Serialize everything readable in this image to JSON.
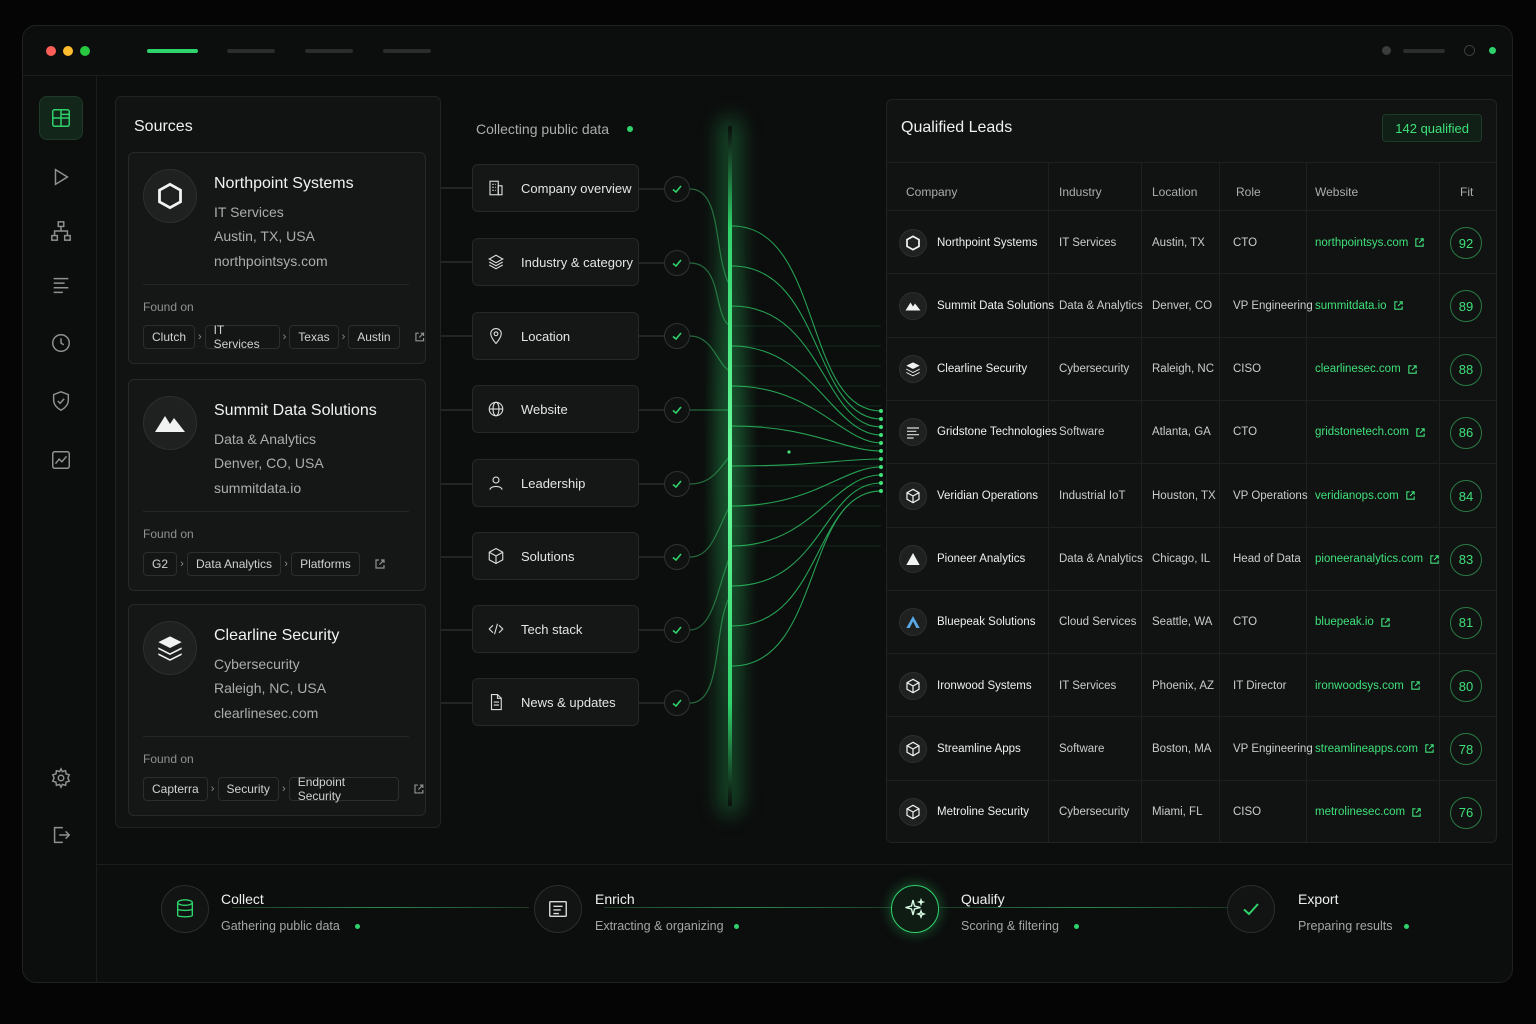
{
  "sources": {
    "title": "Sources",
    "found_label": "Found on",
    "cards": [
      {
        "name": "Northpoint Systems",
        "industry": "IT Services",
        "location": "Austin, TX, USA",
        "website": "northpointsys.com",
        "logo": "hexagon-logo-icon",
        "crumbs": [
          "Clutch",
          "IT Services",
          "Texas",
          "Austin"
        ]
      },
      {
        "name": "Summit Data Solutions",
        "industry": "Data & Analytics",
        "location": "Denver, CO, USA",
        "website": "summitdata.io",
        "logo": "mountain-logo-icon",
        "crumbs": [
          "G2",
          "Data Analytics",
          "Platforms"
        ]
      },
      {
        "name": "Clearline Security",
        "industry": "Cybersecurity",
        "location": "Raleigh, NC, USA",
        "website": "clearlinesec.com",
        "logo": "layers-logo-icon",
        "crumbs": [
          "Capterra",
          "Security",
          "Endpoint Security"
        ]
      }
    ]
  },
  "collecting": {
    "title": "Collecting public data",
    "fields": [
      {
        "label": "Company overview",
        "icon": "building-icon"
      },
      {
        "label": "Industry & category",
        "icon": "layers-icon"
      },
      {
        "label": "Location",
        "icon": "map-pin-icon"
      },
      {
        "label": "Website",
        "icon": "globe-icon"
      },
      {
        "label": "Leadership",
        "icon": "person-icon"
      },
      {
        "label": "Solutions",
        "icon": "cube-icon"
      },
      {
        "label": "Tech stack",
        "icon": "code-icon"
      },
      {
        "label": "News & updates",
        "icon": "document-icon"
      }
    ]
  },
  "leads": {
    "title": "Qualified Leads",
    "count": "142 qualified",
    "columns": [
      "Company",
      "Industry",
      "Location",
      "Role",
      "Website",
      "Fit"
    ],
    "rows": [
      {
        "company": "Northpoint Systems",
        "industry": "IT Services",
        "location": "Austin, TX",
        "role": "CTO",
        "website": "northpointsys.com",
        "fit": "92",
        "logo": "hexagon"
      },
      {
        "company": "Summit Data Solutions",
        "industry": "Data & Analytics",
        "location": "Denver, CO",
        "role": "VP Engineering",
        "website": "summitdata.io",
        "fit": "89",
        "logo": "mountain"
      },
      {
        "company": "Clearline Security",
        "industry": "Cybersecurity",
        "location": "Raleigh, NC",
        "role": "CISO",
        "website": "clearlinesec.com",
        "fit": "88",
        "logo": "layers"
      },
      {
        "company": "Gridstone Technologies",
        "industry": "Software",
        "location": "Atlanta, GA",
        "role": "CTO",
        "website": "gridstonetech.com",
        "fit": "86",
        "logo": "lines"
      },
      {
        "company": "Veridian Operations",
        "industry": "Industrial IoT",
        "location": "Houston, TX",
        "role": "VP Operations",
        "website": "veridianops.com",
        "fit": "84",
        "logo": "cube"
      },
      {
        "company": "Pioneer Analytics",
        "industry": "Data & Analytics",
        "location": "Chicago, IL",
        "role": "Head of Data",
        "website": "pioneeranalytics.com",
        "fit": "83",
        "logo": "triangle"
      },
      {
        "company": "Bluepeak Solutions",
        "industry": "Cloud Services",
        "location": "Seattle, WA",
        "role": "CTO",
        "website": "bluepeak.io",
        "fit": "81",
        "logo": "peak"
      },
      {
        "company": "Ironwood Systems",
        "industry": "IT Services",
        "location": "Phoenix, AZ",
        "role": "IT Director",
        "website": "ironwoodsys.com",
        "fit": "80",
        "logo": "cube"
      },
      {
        "company": "Streamline Apps",
        "industry": "Software",
        "location": "Boston, MA",
        "role": "VP Engineering",
        "website": "streamlineapps.com",
        "fit": "78",
        "logo": "cube"
      },
      {
        "company": "Metroline Security",
        "industry": "Cybersecurity",
        "location": "Miami, FL",
        "role": "CISO",
        "website": "metrolinesec.com",
        "fit": "76",
        "logo": "cube"
      }
    ]
  },
  "pipeline": {
    "stages": [
      {
        "title": "Collect",
        "sub": "Gathering public data",
        "icon": "database-icon"
      },
      {
        "title": "Enrich",
        "sub": "Extracting & organizing",
        "icon": "list-icon"
      },
      {
        "title": "Qualify",
        "sub": "Scoring & filtering",
        "icon": "sparkle-icon"
      },
      {
        "title": "Export",
        "sub": "Preparing results",
        "icon": "check-icon"
      }
    ]
  },
  "colors": {
    "accent": "#2fd36b",
    "bg": "#0c0d0d",
    "panel": "#111312"
  }
}
